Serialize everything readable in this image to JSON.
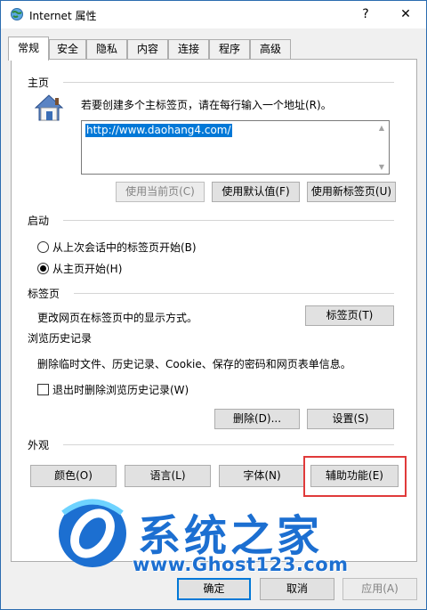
{
  "window": {
    "title": "Internet 属性",
    "help": "?",
    "close": "✕"
  },
  "tabs": [
    "常规",
    "安全",
    "隐私",
    "内容",
    "连接",
    "程序",
    "高级"
  ],
  "homepage": {
    "label": "主页",
    "desc": "若要创建多个主标签页，请在每行输入一个地址(R)。",
    "url": "http://www.daohang4.com/",
    "use_current": "使用当前页(C)",
    "use_default": "使用默认值(F)",
    "use_new_tab": "使用新标签页(U)"
  },
  "startup": {
    "label": "启动",
    "option1": "从上次会话中的标签页开始(B)",
    "option2": "从主页开始(H)",
    "selected": 2
  },
  "tabs_section": {
    "label": "标签页",
    "desc": "更改网页在标签页中的显示方式。",
    "button": "标签页(T)"
  },
  "history": {
    "label": "浏览历史记录",
    "desc": "删除临时文件、历史记录、Cookie、保存的密码和网页表单信息。",
    "checkbox": "退出时删除浏览历史记录(W)",
    "delete": "删除(D)...",
    "settings": "设置(S)"
  },
  "appearance": {
    "label": "外观",
    "colors": "颜色(O)",
    "languages": "语言(L)",
    "fonts": "字体(N)",
    "accessibility": "辅助功能(E)"
  },
  "footer": {
    "ok": "确定",
    "cancel": "取消",
    "apply": "应用(A)"
  },
  "watermark": {
    "title": "系统之家",
    "url": "www.Ghost123.com"
  },
  "colors": {
    "accent": "#0078d7",
    "highlight": "#e03a3a",
    "watermark": "#1c6fd1"
  }
}
